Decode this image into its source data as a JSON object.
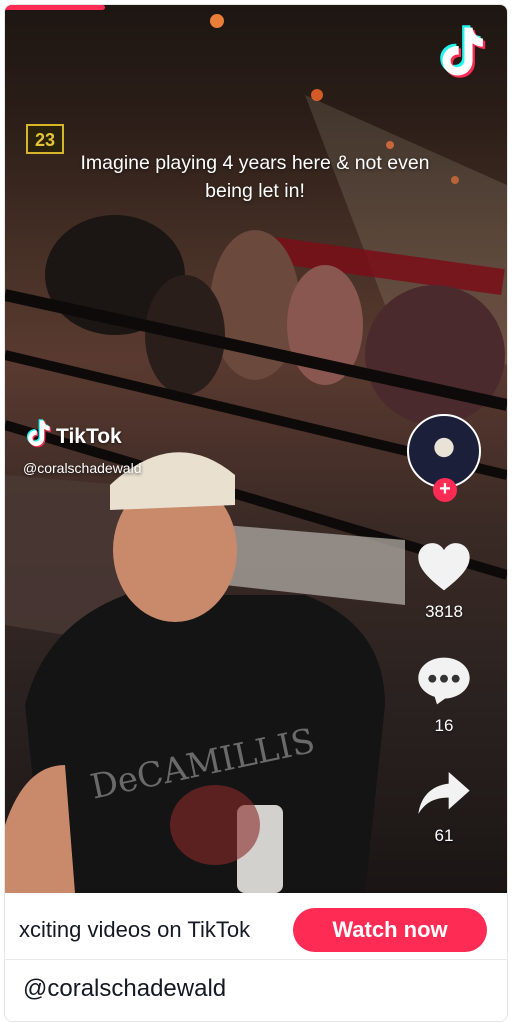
{
  "video": {
    "caption": "Imagine playing 4 years here & not even being let in!",
    "progress_fraction": 0.2,
    "watermark": {
      "brand": "TikTok",
      "username": "@coralschadewald"
    }
  },
  "actions": {
    "likes": "3818",
    "comments": "16",
    "shares": "61"
  },
  "bottom_bar": {
    "promo_text": "xciting videos on TikTok",
    "watch_button": "Watch now"
  },
  "author": {
    "handle": "@coralschadewald"
  },
  "colors": {
    "accent": "#fe2c55",
    "tiktok_cyan": "#25f4ee",
    "text_dark": "#161823"
  },
  "icons": {
    "corner_logo": "tiktok-logo-icon",
    "like": "heart-icon",
    "comment": "comment-bubble-icon",
    "share": "share-arrow-icon",
    "follow": "plus-icon"
  }
}
